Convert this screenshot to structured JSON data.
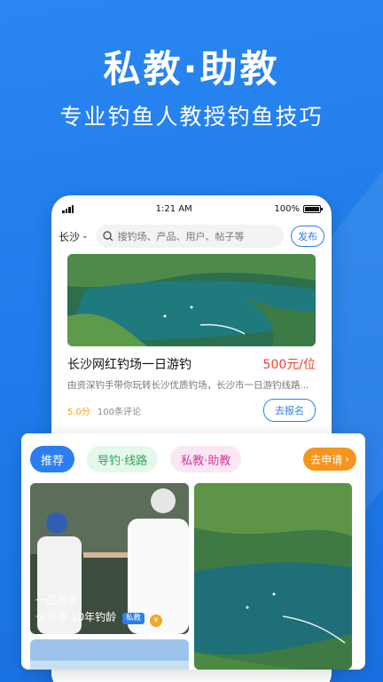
{
  "hero": {
    "title": "私教·助教",
    "subtitle": "专业钓鱼人教授钓鱼技巧"
  },
  "status_bar": {
    "time": "1:21 AM",
    "battery": "100%"
  },
  "search_row": {
    "city": "长沙",
    "search_placeholder": "搜钓场、产品、用户、帖子等",
    "publish_label": "发布"
  },
  "card": {
    "title": "长沙网红钓场一日游钓",
    "price": "500元/位",
    "description": "由资深钓手带你玩转长沙优质钓场，长沙市一日游钓线路...",
    "score": "5.0分",
    "reviews": "100条评论",
    "signup_label": "去报名"
  },
  "panel": {
    "tabs": [
      {
        "label": "推荐"
      },
      {
        "label": "导钓·线路"
      },
      {
        "label": "私教·助教"
      }
    ],
    "apply_label": "去申请",
    "tile_a": {
      "line1": "一品高手",
      "line2": "长沙市 10年钓龄",
      "badge": "私教"
    }
  },
  "colors": {
    "brand_blue": "#2b7ef0",
    "price_red": "#e8452b",
    "guide_green": "#2aaa5a",
    "coach_pink": "#d63a9b",
    "apply_orange": "#f5951d"
  }
}
